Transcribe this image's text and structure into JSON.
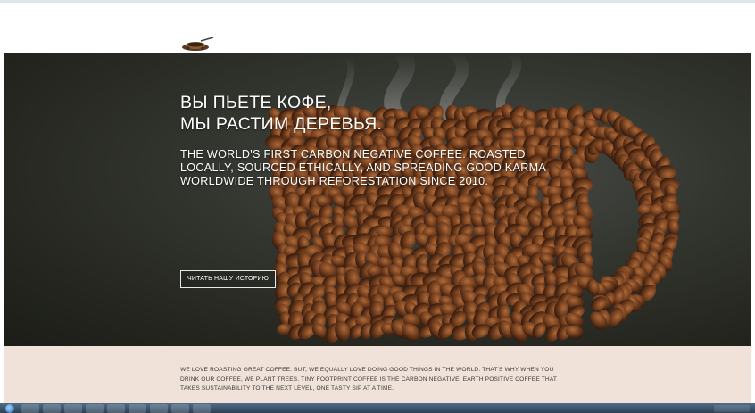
{
  "hero": {
    "title_line1": "ВЫ ПЬЕТЕ КОФЕ,",
    "title_line2": "МЫ РАСТИМ ДЕРЕВЬЯ.",
    "subtitle": "THE WORLD'S FIRST CARBON NEGATIVE COFFEE. ROASTED LOCALLY, SOURCED ETHICALLY, AND SPREADING GOOD KARMA WORLDWIDE THROUGH REFORESTATION SINCE 2010.",
    "button_label": "ЧИТАТЬ НАШУ ИСТОРИЮ"
  },
  "about": {
    "text": "WE LOVE ROASTING GREAT COFFEE. BUT, WE EQUALLY LOVE DOING GOOD THINGS IN THE WORLD. THAT'S WHY WHEN YOU DRINK OUR COFFEE, WE PLANT TREES. TINY FOOTPRINT COFFEE IS THE CARBON NEGATIVE, EARTH POSITIVE COFFEE THAT TAKES SUSTAINABILITY TO THE NEXT LEVEL, ONE TASTY SIP AT A TIME."
  },
  "icons": {
    "logo": "coffee-cup-logo",
    "taskbar_start": "windows-start-icon"
  },
  "colors": {
    "hero_background": "#2a2c26",
    "about_background": "#f0e2d8",
    "bean_brown": "#6b3a1c"
  }
}
